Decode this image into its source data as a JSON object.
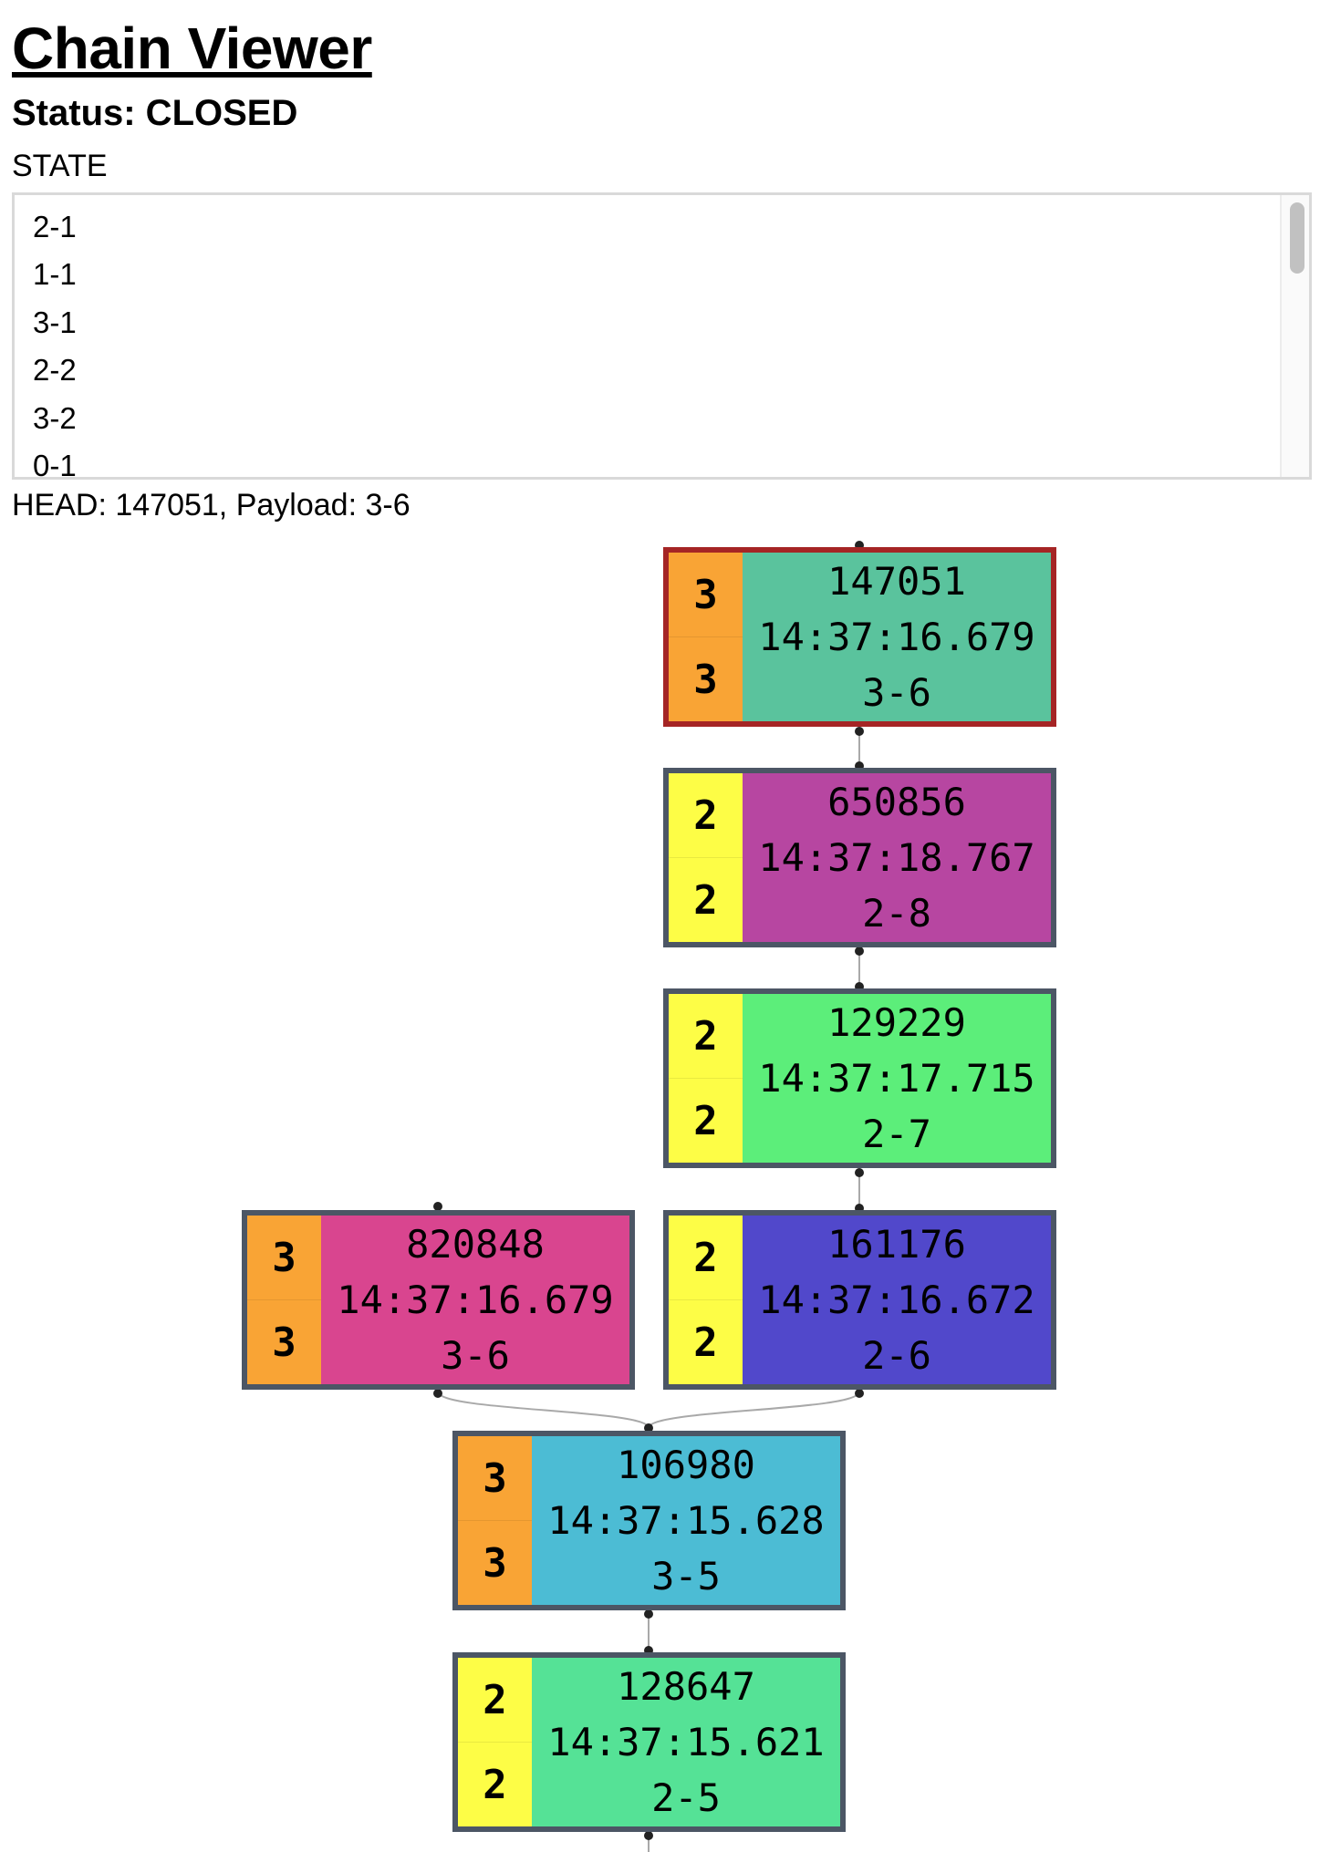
{
  "page": {
    "title": "Chain Viewer",
    "status": "Status: CLOSED",
    "state_label": "STATE",
    "head_line": "HEAD: 147051, Payload: 3-6"
  },
  "state_list": [
    "2-1",
    "1-1",
    "3-1",
    "2-2",
    "3-2",
    "0-1"
  ],
  "colors": {
    "node_border": "#4c5665",
    "head_border": "#a52525",
    "sidebar_orange": "#f9a435",
    "sidebar_yellow": "#fdfd46",
    "edge": "#a9a9a9",
    "dot": "#222222"
  },
  "nodes": [
    {
      "id": "147051",
      "time": "14:37:16.679",
      "payload": "3-6",
      "top": "3",
      "bottom": "3",
      "sidebar_color": "#f9a435",
      "color": "#5ac39d",
      "is_head": true
    },
    {
      "id": "650856",
      "time": "14:37:18.767",
      "payload": "2-8",
      "top": "2",
      "bottom": "2",
      "sidebar_color": "#fdfd46",
      "color": "#b746a1",
      "is_head": false
    },
    {
      "id": "129229",
      "time": "14:37:17.715",
      "payload": "2-7",
      "top": "2",
      "bottom": "2",
      "sidebar_color": "#fdfd46",
      "color": "#5cee7a",
      "is_head": false
    },
    {
      "id": "820848",
      "time": "14:37:16.679",
      "payload": "3-6",
      "top": "3",
      "bottom": "3",
      "sidebar_color": "#f9a435",
      "color": "#d9458f",
      "is_head": false
    },
    {
      "id": "161176",
      "time": "14:37:16.672",
      "payload": "2-6",
      "top": "2",
      "bottom": "2",
      "sidebar_color": "#fdfd46",
      "color": "#5148cb",
      "is_head": false
    },
    {
      "id": "106980",
      "time": "14:37:15.628",
      "payload": "3-5",
      "top": "3",
      "bottom": "3",
      "sidebar_color": "#f9a435",
      "color": "#4cbcd4",
      "is_head": false
    },
    {
      "id": "128647",
      "time": "14:37:15.621",
      "payload": "2-5",
      "top": "2",
      "bottom": "2",
      "sidebar_color": "#fdfd46",
      "color": "#55e296",
      "is_head": false
    }
  ]
}
